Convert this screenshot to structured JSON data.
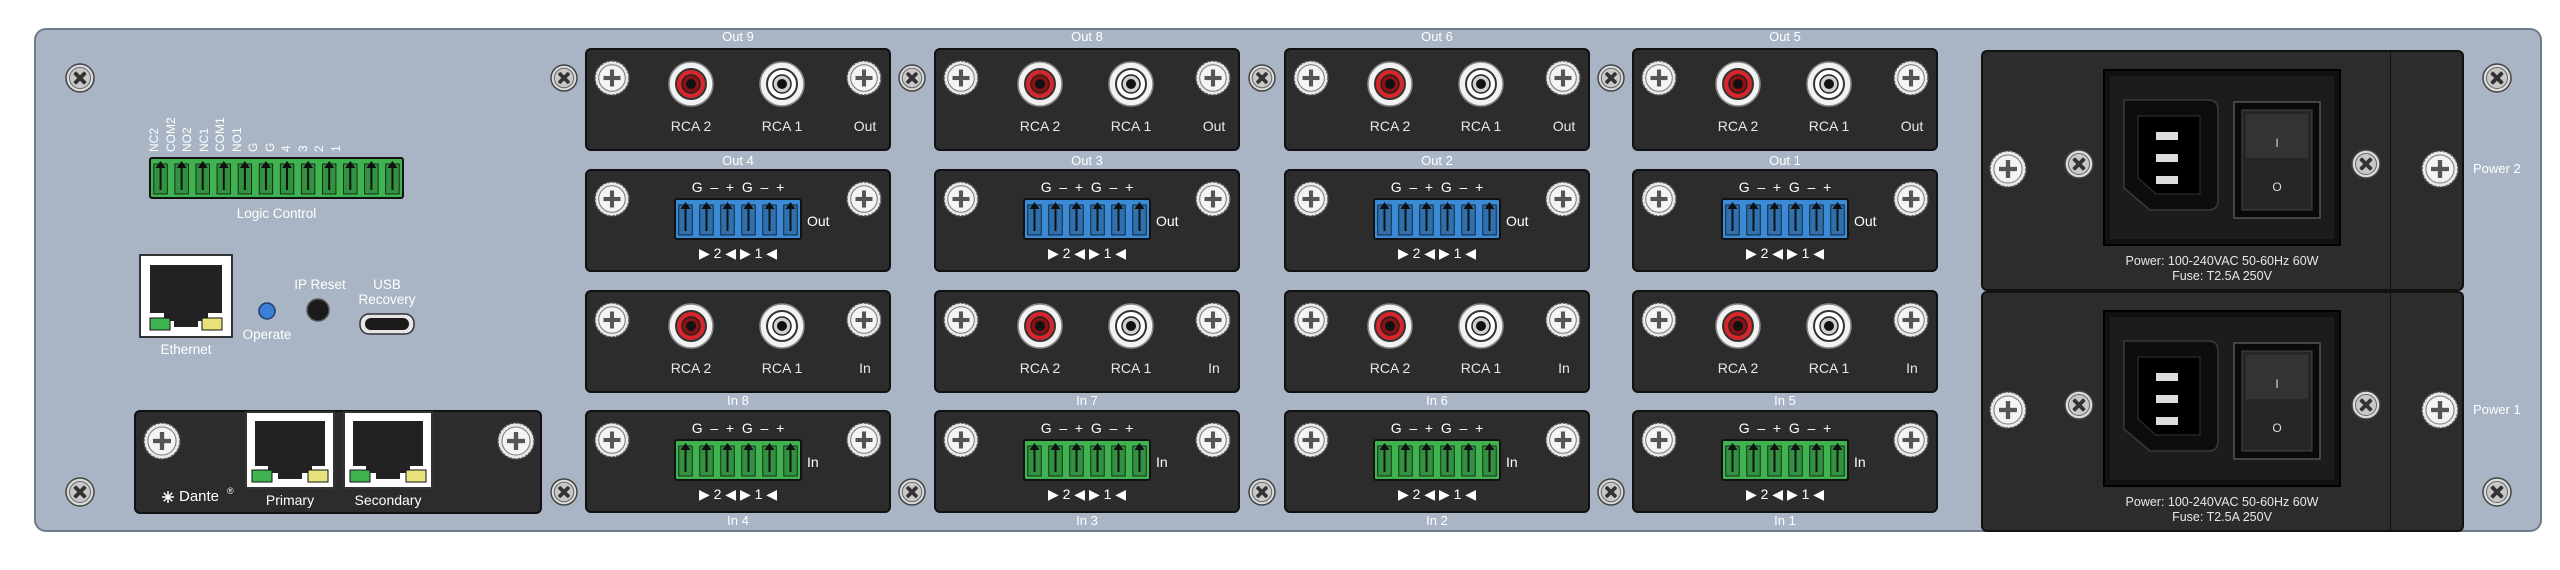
{
  "panel": {
    "logic": {
      "pins": [
        "NC2",
        "COM2",
        "NO2",
        "NC1",
        "COM1",
        "NO1",
        "G",
        "G",
        "4",
        "3",
        "2",
        "1"
      ],
      "label": "Logic Control"
    },
    "network": {
      "ethernet_label": "Ethernet",
      "operate_label": "Operate",
      "ip_reset_label": "IP Reset",
      "usb_label_1": "USB",
      "usb_label_2": "Recovery"
    },
    "dante": {
      "brand": "Dante",
      "brand_mark": "®",
      "primary_label": "Primary",
      "secondary_label": "Secondary"
    },
    "columns": [
      {
        "out_rca": "Out 9",
        "out_tb": "Out 4",
        "in_rca": "In 8",
        "in_tb": "In 4"
      },
      {
        "out_rca": "Out 8",
        "out_tb": "Out 3",
        "in_rca": "In 7",
        "in_tb": "In 3"
      },
      {
        "out_rca": "Out 6",
        "out_tb": "Out 2",
        "in_rca": "In 6",
        "in_tb": "In 2"
      },
      {
        "out_rca": "Out 5",
        "out_tb": "Out 1",
        "in_rca": "In 5",
        "in_tb": "In 1"
      }
    ],
    "jack_labels": {
      "rca2": "RCA 2",
      "rca1": "RCA 1",
      "out": "Out",
      "in": "In"
    },
    "tb_pins": "G  –  +  G  –  +",
    "tb_channels": "▶ 2 ◀ ▶ 1 ◀",
    "power": [
      {
        "label": "Power 2",
        "spec": "Power: 100-240VAC 50-60Hz 60W",
        "fuse": "Fuse: T2.5A 250V"
      },
      {
        "label": "Power 1",
        "spec": "Power: 100-240VAC 50-60Hz 60W",
        "fuse": "Fuse: T2.5A 250V"
      }
    ],
    "switch_on": "I",
    "switch_off": "O",
    "colors": {
      "chassis": "#a9b5c4",
      "module": "#2c2c2c",
      "rca_red": "#d7262b",
      "green_tb": "#3fb34f",
      "blue_tb": "#3a8ad6"
    }
  }
}
